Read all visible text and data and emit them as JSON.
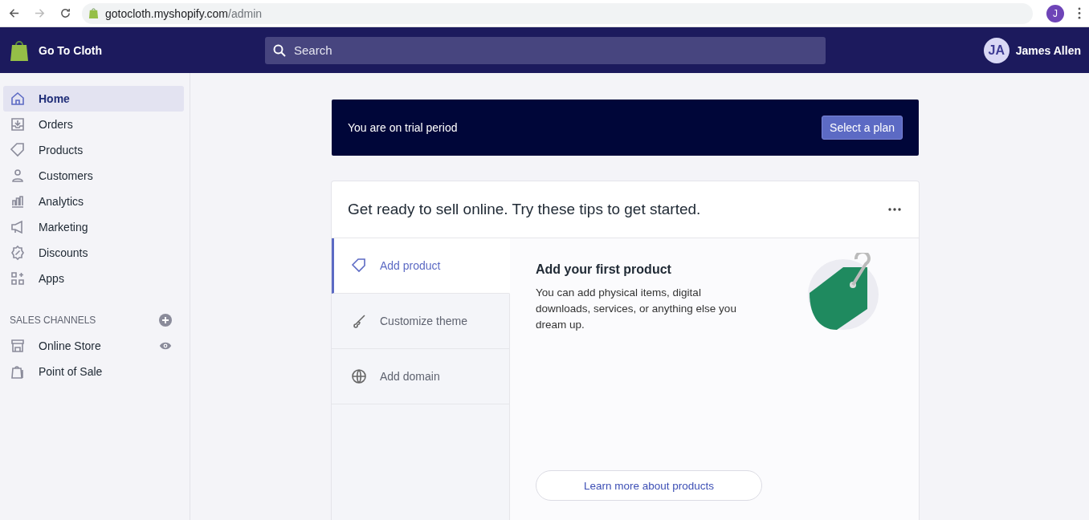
{
  "browser": {
    "url_host": "gotocloth.myshopify.com",
    "url_path": "/admin",
    "profile_initial": "J"
  },
  "topbar": {
    "store_name": "Go To Cloth",
    "search": {
      "placeholder": "Search"
    },
    "user": {
      "initials": "JA",
      "name": "James Allen"
    }
  },
  "sidebar": {
    "items": [
      {
        "label": "Home",
        "selected": true
      },
      {
        "label": "Orders",
        "selected": false
      },
      {
        "label": "Products",
        "selected": false
      },
      {
        "label": "Customers",
        "selected": false
      },
      {
        "label": "Analytics",
        "selected": false
      },
      {
        "label": "Marketing",
        "selected": false
      },
      {
        "label": "Discounts",
        "selected": false
      },
      {
        "label": "Apps",
        "selected": false
      }
    ],
    "sales_channels": {
      "heading": "SALES CHANNELS",
      "items": [
        {
          "label": "Online Store"
        },
        {
          "label": "Point of Sale"
        }
      ]
    }
  },
  "trial_banner": {
    "text": "You are on trial period",
    "button": "Select a plan"
  },
  "tips_card": {
    "title": "Get ready to sell online. Try these tips to get started.",
    "tabs": [
      {
        "label": "Add product",
        "selected": true
      },
      {
        "label": "Customize theme",
        "selected": false
      },
      {
        "label": "Add domain",
        "selected": false
      }
    ],
    "detail": {
      "heading": "Add your first product",
      "body": "You can add physical items, digital downloads, services, or anything else you dream up.",
      "button": "Learn more about products"
    }
  }
}
